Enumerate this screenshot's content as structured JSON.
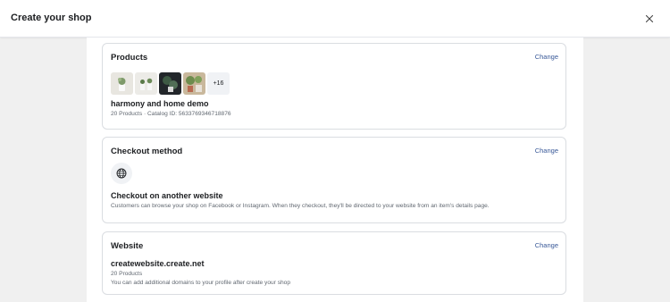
{
  "header": {
    "title": "Create your shop",
    "close_icon": "close-icon"
  },
  "products": {
    "title": "Products",
    "change_label": "Change",
    "more_count": "+16",
    "catalog_name": "harmony and home demo",
    "catalog_meta": "20 Products · Catalog ID: 5633769346718876"
  },
  "checkout": {
    "title": "Checkout method",
    "change_label": "Change",
    "icon": "globe-icon",
    "method_name": "Checkout on another website",
    "description": "Customers can browse your shop on Facebook or Instagram. When they checkout, they'll be directed to your website from an item's details page."
  },
  "website": {
    "title": "Website",
    "change_label": "Change",
    "domain": "createwebsite.create.net",
    "product_count": "20 Products",
    "note": "You can add additional domains to your profile after create your shop"
  },
  "colors": {
    "link": "#385898",
    "background": "#f0f0f0",
    "card_border": "#dadde1"
  }
}
